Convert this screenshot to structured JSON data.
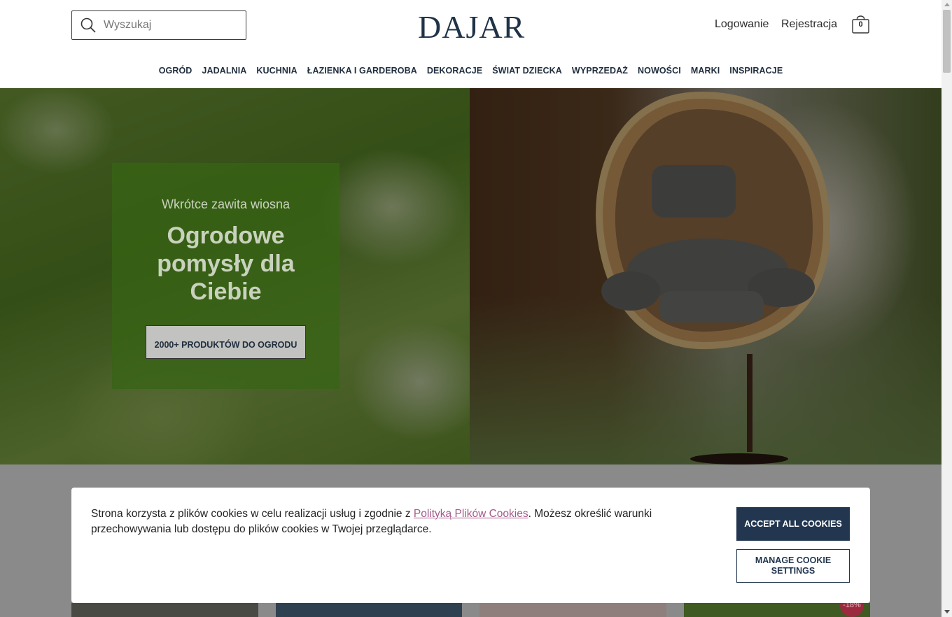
{
  "header": {
    "search_placeholder": "Wyszukaj",
    "logo": "DAJAR",
    "login": "Logowanie",
    "register": "Rejestracja",
    "cart_count": "0"
  },
  "nav": {
    "items": [
      "OGRÓD",
      "JADALNIA",
      "KUCHNIA",
      "ŁAZIENKA I GARDEROBA",
      "DEKORACJE",
      "ŚWIAT DZIECKA",
      "WYPRZEDAŻ",
      "NOWOŚCI",
      "MARKI",
      "INSPIRACJE"
    ]
  },
  "hero": {
    "subtitle": "Wkrótce zawita wiosna",
    "title": "Ogrodowe pomysły dla Ciebie",
    "button": "2000+ PRODUKTÓW DO OGRODU"
  },
  "products": {
    "discount_badge": "-18%"
  },
  "cookie": {
    "text_before": "Strona korzysta z plików cookies w celu realizacji usług i zgodnie z ",
    "link": "Polityką Plików Cookies",
    "text_after": ". Możesz określić warunki przechowywania lub dostępu do plików cookies w Twojej przeglądarce.",
    "accept": "ACCEPT ALL COOKIES",
    "manage": "MANAGE COOKIE SETTINGS"
  },
  "colors": {
    "brand_navy": "#22364f",
    "link_pink": "#a35a8a",
    "badge_red": "#9c2a3e"
  }
}
